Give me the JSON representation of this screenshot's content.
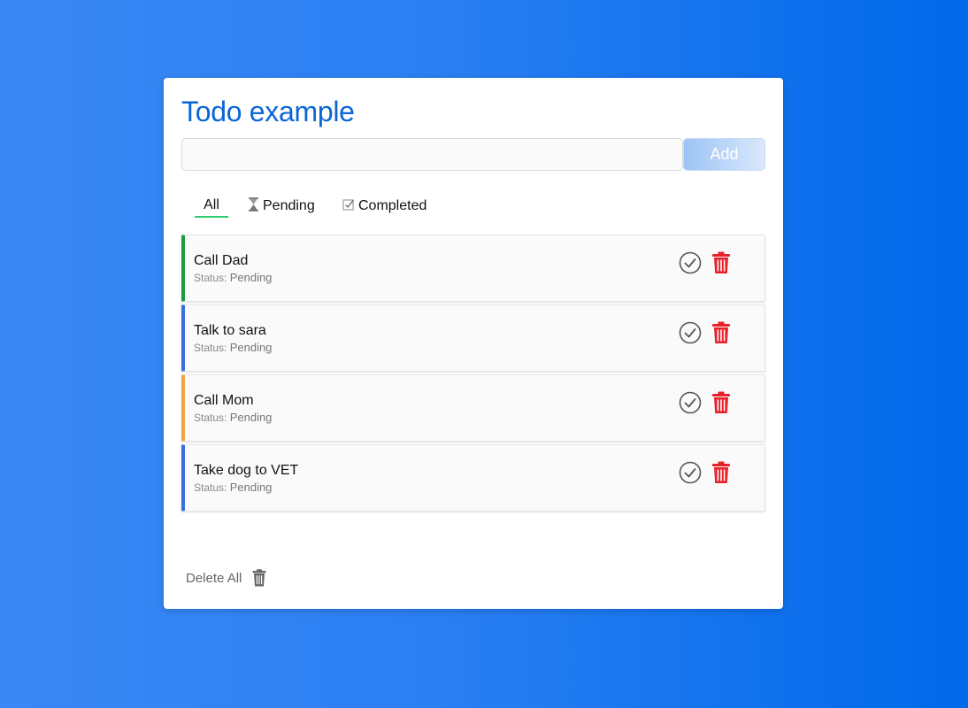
{
  "app": {
    "title": "Todo example"
  },
  "input": {
    "value": "",
    "placeholder": ""
  },
  "add_button": {
    "label": "Add"
  },
  "tabs": [
    {
      "label": "All",
      "icon": "none",
      "active": true
    },
    {
      "label": "Pending",
      "icon": "hourglass-icon",
      "active": false
    },
    {
      "label": "Completed",
      "icon": "checkbox-icon",
      "active": false
    }
  ],
  "todos": [
    {
      "text": "Call Dad",
      "status_label": "Status:",
      "status": "Pending",
      "accent": "#1e9c3f"
    },
    {
      "text": "Talk to sara",
      "status_label": "Status:",
      "status": "Pending",
      "accent": "#3a6fe0"
    },
    {
      "text": "Call Mom",
      "status_label": "Status:",
      "status": "Pending",
      "accent": "#f0a54a"
    },
    {
      "text": "Take dog to VET",
      "status_label": "Status:",
      "status": "Pending",
      "accent": "#3a6fe0"
    }
  ],
  "footer": {
    "delete_all_label": "Delete All"
  },
  "colors": {
    "title": "#0a66d8",
    "active_tab_underline": "#2ecc71",
    "trash": "#e8202a",
    "check": "#555555"
  }
}
